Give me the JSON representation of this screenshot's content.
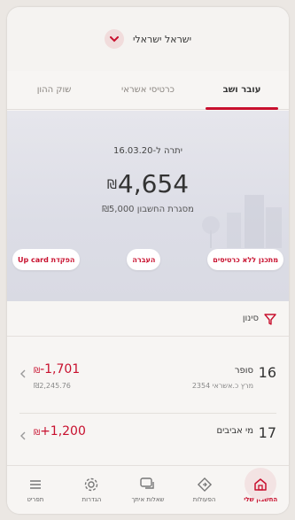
{
  "account": {
    "selected": "ישראל ישראלי",
    "chevron_icon": "chevron-down-icon"
  },
  "tabs": [
    {
      "label": "עובר ושב",
      "active": true
    },
    {
      "label": "כרטיסי אשראי",
      "active": false
    },
    {
      "label": "שוק ההון",
      "active": false
    }
  ],
  "balance": {
    "date_text": "יתרה ל-16.03.20",
    "currency": "₪",
    "amount": "4,654",
    "limit_text": "מסגרת החשבון ₪5,000"
  },
  "actions": [
    {
      "label": "מתכנן ללא כרטיסים"
    },
    {
      "label": "העברה"
    },
    {
      "label": "הפקדת Up card"
    }
  ],
  "filter": {
    "label": "סינון",
    "icon": "filter-icon"
  },
  "transactions": [
    {
      "day": "16",
      "merchant": "סופר",
      "sub": "מרץ כ.אשראי 2354",
      "currency": "₪",
      "amount": "-1,701",
      "original": "₪2,245.76"
    },
    {
      "day": "17",
      "merchant": "מי אביבים",
      "sub": "",
      "currency": "₪",
      "amount": "+1,200",
      "original": ""
    }
  ],
  "bottom_nav": [
    {
      "label": "החשבון שלי",
      "icon": "home-icon",
      "active": true
    },
    {
      "label": "הפעולות",
      "icon": "actions-icon",
      "active": false
    },
    {
      "label": "שאלות איתך",
      "icon": "chat-icon",
      "active": false
    },
    {
      "label": "הגדרות",
      "icon": "settings-icon",
      "active": false
    },
    {
      "label": "תפריט",
      "icon": "menu-icon",
      "active": false
    }
  ],
  "colors": {
    "accent": "#c8102e",
    "background": "#f7f5f3",
    "balance_bg": "#dcdde6"
  }
}
